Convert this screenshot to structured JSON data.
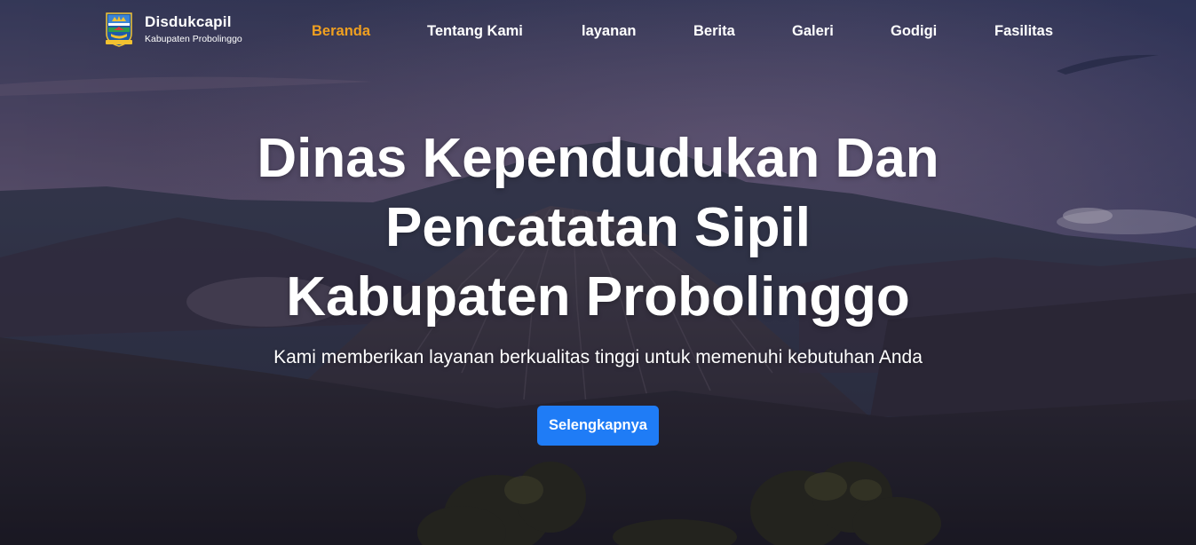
{
  "brand": {
    "title": "Disdukcapil",
    "subtitle": "Kabupaten Probolinggo",
    "logo_icon": "probolinggo-crest-icon"
  },
  "nav": {
    "items": [
      {
        "label": "Beranda",
        "active": true
      },
      {
        "label": "Tentang Kami",
        "active": false
      },
      {
        "label": "layanan",
        "active": false
      },
      {
        "label": "Berita",
        "active": false
      },
      {
        "label": "Galeri",
        "active": false
      },
      {
        "label": "Godigi",
        "active": false
      },
      {
        "label": "Fasilitas",
        "active": false
      }
    ],
    "active_color": "#f0a020",
    "text_color": "#ffffff"
  },
  "hero": {
    "title_lines": [
      "Dinas Kependudukan Dan",
      "Pencatatan Sipil",
      "Kabupaten Probolinggo"
    ],
    "subtitle": "Kami memberikan layanan berkualitas tinggi untuk memenuhi kebutuhan Anda",
    "cta_label": "Selengkapnya",
    "cta_color": "#1f7cf6"
  }
}
